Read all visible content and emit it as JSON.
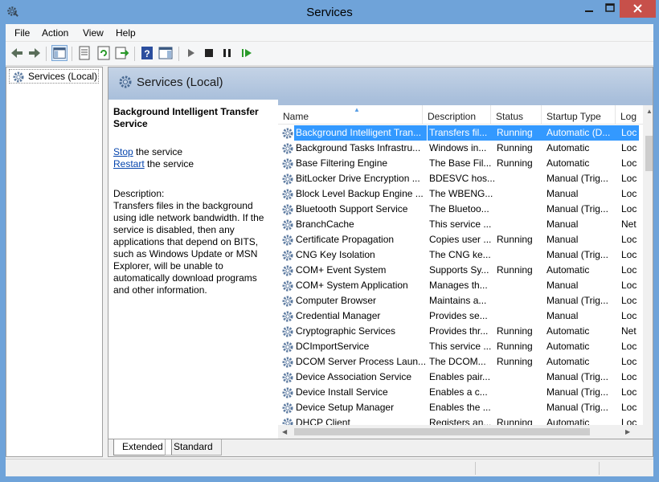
{
  "window": {
    "title": "Services",
    "icon": "services-gear-icon",
    "controls": [
      "minimize-icon",
      "maximize-icon",
      "close-icon"
    ]
  },
  "menu": [
    "File",
    "Action",
    "View",
    "Help"
  ],
  "toolbar": [
    "back-icon",
    "forward-icon",
    "show-hide-console-tree-icon",
    "properties-icon",
    "refresh-icon",
    "export-list-icon",
    "help-icon",
    "action-pane-icon",
    "start-service-icon",
    "stop-service-icon",
    "pause-service-icon",
    "restart-service-icon"
  ],
  "tree": {
    "root": "Services (Local)"
  },
  "panel": {
    "title": "Services (Local)",
    "selected_service": "Background Intelligent Transfer Service",
    "action_stop_link": "Stop",
    "action_stop_suffix": " the service",
    "action_restart_link": "Restart",
    "action_restart_suffix": " the service",
    "description_label": "Description:",
    "description_text": "Transfers files in the background using idle network bandwidth. If the service is disabled, then any applications that depend on BITS, such as Windows Update or MSN Explorer, will be unable to automatically download programs and other information."
  },
  "columns": [
    "Name",
    "Description",
    "Status",
    "Startup Type",
    "Log"
  ],
  "services": [
    {
      "name": "Background Intelligent Tran...",
      "description": "Transfers fil...",
      "status": "Running",
      "startup": "Automatic (D...",
      "log": "Loc"
    },
    {
      "name": "Background Tasks Infrastru...",
      "description": "Windows in...",
      "status": "Running",
      "startup": "Automatic",
      "log": "Loc"
    },
    {
      "name": "Base Filtering Engine",
      "description": "The Base Fil...",
      "status": "Running",
      "startup": "Automatic",
      "log": "Loc"
    },
    {
      "name": "BitLocker Drive Encryption ...",
      "description": "BDESVC hos...",
      "status": "",
      "startup": "Manual (Trig...",
      "log": "Loc"
    },
    {
      "name": "Block Level Backup Engine ...",
      "description": "The WBENG...",
      "status": "",
      "startup": "Manual",
      "log": "Loc"
    },
    {
      "name": "Bluetooth Support Service",
      "description": "The Bluetoo...",
      "status": "",
      "startup": "Manual (Trig...",
      "log": "Loc"
    },
    {
      "name": "BranchCache",
      "description": "This service ...",
      "status": "",
      "startup": "Manual",
      "log": "Net"
    },
    {
      "name": "Certificate Propagation",
      "description": "Copies user ...",
      "status": "Running",
      "startup": "Manual",
      "log": "Loc"
    },
    {
      "name": "CNG Key Isolation",
      "description": "The CNG ke...",
      "status": "",
      "startup": "Manual (Trig...",
      "log": "Loc"
    },
    {
      "name": "COM+ Event System",
      "description": "Supports Sy...",
      "status": "Running",
      "startup": "Automatic",
      "log": "Loc"
    },
    {
      "name": "COM+ System Application",
      "description": "Manages th...",
      "status": "",
      "startup": "Manual",
      "log": "Loc"
    },
    {
      "name": "Computer Browser",
      "description": "Maintains a...",
      "status": "",
      "startup": "Manual (Trig...",
      "log": "Loc"
    },
    {
      "name": "Credential Manager",
      "description": "Provides se...",
      "status": "",
      "startup": "Manual",
      "log": "Loc"
    },
    {
      "name": "Cryptographic Services",
      "description": "Provides thr...",
      "status": "Running",
      "startup": "Automatic",
      "log": "Net"
    },
    {
      "name": "DCImportService",
      "description": "This service ...",
      "status": "Running",
      "startup": "Automatic",
      "log": "Loc"
    },
    {
      "name": "DCOM Server Process Laun...",
      "description": "The DCOM...",
      "status": "Running",
      "startup": "Automatic",
      "log": "Loc"
    },
    {
      "name": "Device Association Service",
      "description": "Enables pair...",
      "status": "",
      "startup": "Manual (Trig...",
      "log": "Loc"
    },
    {
      "name": "Device Install Service",
      "description": "Enables a c...",
      "status": "",
      "startup": "Manual (Trig...",
      "log": "Loc"
    },
    {
      "name": "Device Setup Manager",
      "description": "Enables the ...",
      "status": "",
      "startup": "Manual (Trig...",
      "log": "Loc"
    },
    {
      "name": "DHCP Client",
      "description": "Registers an...",
      "status": "Running",
      "startup": "Automatic",
      "log": "Loc"
    }
  ],
  "tabs": [
    "Extended",
    "Standard"
  ],
  "colors": {
    "title_bar": "#6fa3d9",
    "selection": "#3399ff",
    "close_button": "#c7504a",
    "link": "#0645ad"
  }
}
